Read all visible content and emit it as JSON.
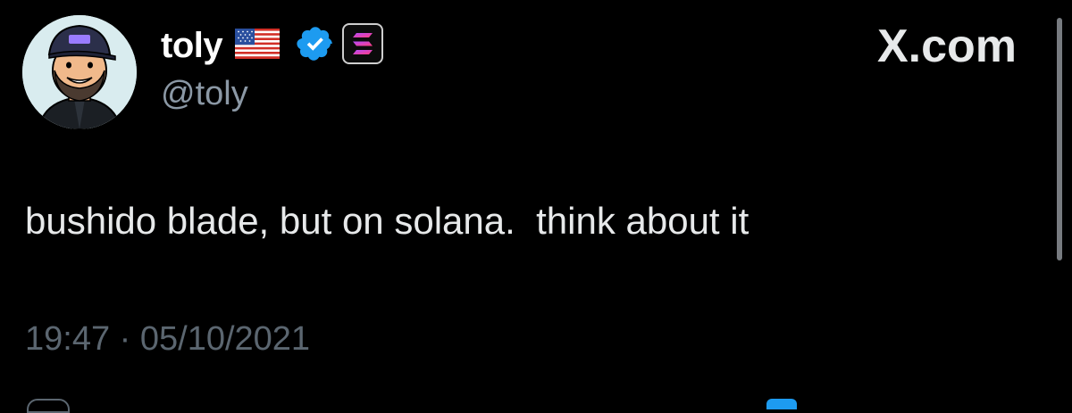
{
  "tweet": {
    "display_name": "toly",
    "handle": "@toly",
    "text": "bushido blade, but on solana.  think about it",
    "timestamp": "19:47 · 05/10/2021",
    "site_label": "X.com"
  },
  "icons": {
    "flag": "us-flag-icon",
    "verified": "verified-badge-icon",
    "affiliate": "solana-badge-icon"
  },
  "colors": {
    "background": "#000000",
    "text": "#e7e9ea",
    "secondary_text": "#8b98a5",
    "timestamp": "#5b6670",
    "verified_blue": "#1d9bf0"
  }
}
